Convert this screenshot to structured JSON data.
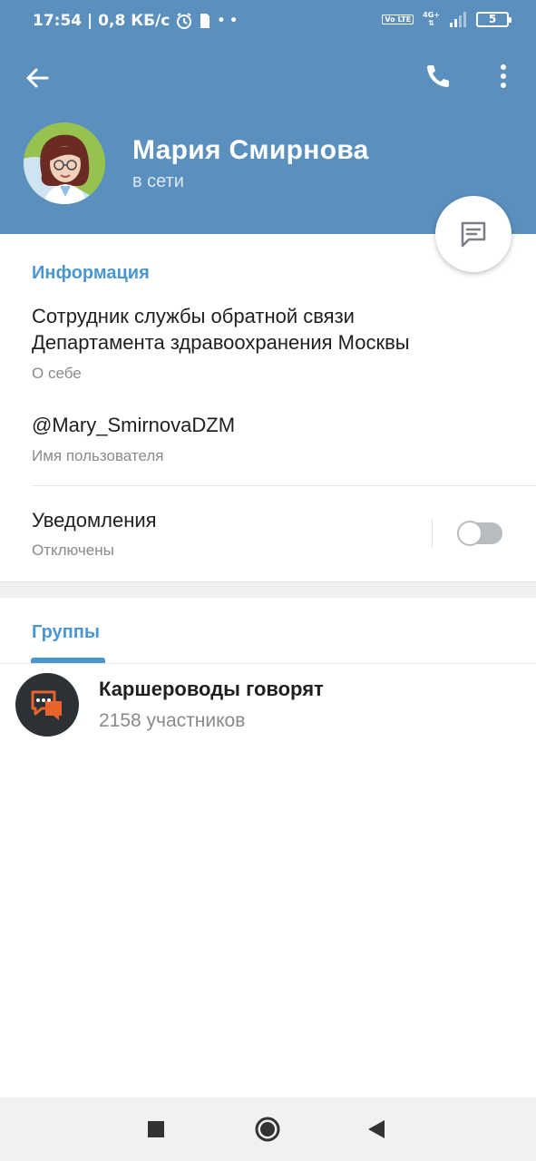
{
  "status_bar": {
    "time_speed": "17:54 | 0,8 КБ/с",
    "volte": "Vo LTE",
    "network": "4G+",
    "battery": "5"
  },
  "header": {
    "name": "Мария Смирнова",
    "status": "в сети"
  },
  "info": {
    "section_title": "Информация",
    "bio_text": "Сотрудник службы обратной связи Департамента здравоохранения Москвы",
    "bio_label": "О себе",
    "username_value": "@Mary_SmirnovaDZM",
    "username_label": "Имя пользователя",
    "notifications_label": "Уведомления",
    "notifications_status": "Отключены",
    "notifications_enabled": false
  },
  "groups": {
    "tab_title": "Группы",
    "items": [
      {
        "name": "Каршероводы говорят",
        "members": "2158 участников"
      }
    ]
  },
  "colors": {
    "header_bg": "#5b8fbd",
    "accent": "#4a97cf",
    "toggle_off": "#b9bcbf"
  }
}
